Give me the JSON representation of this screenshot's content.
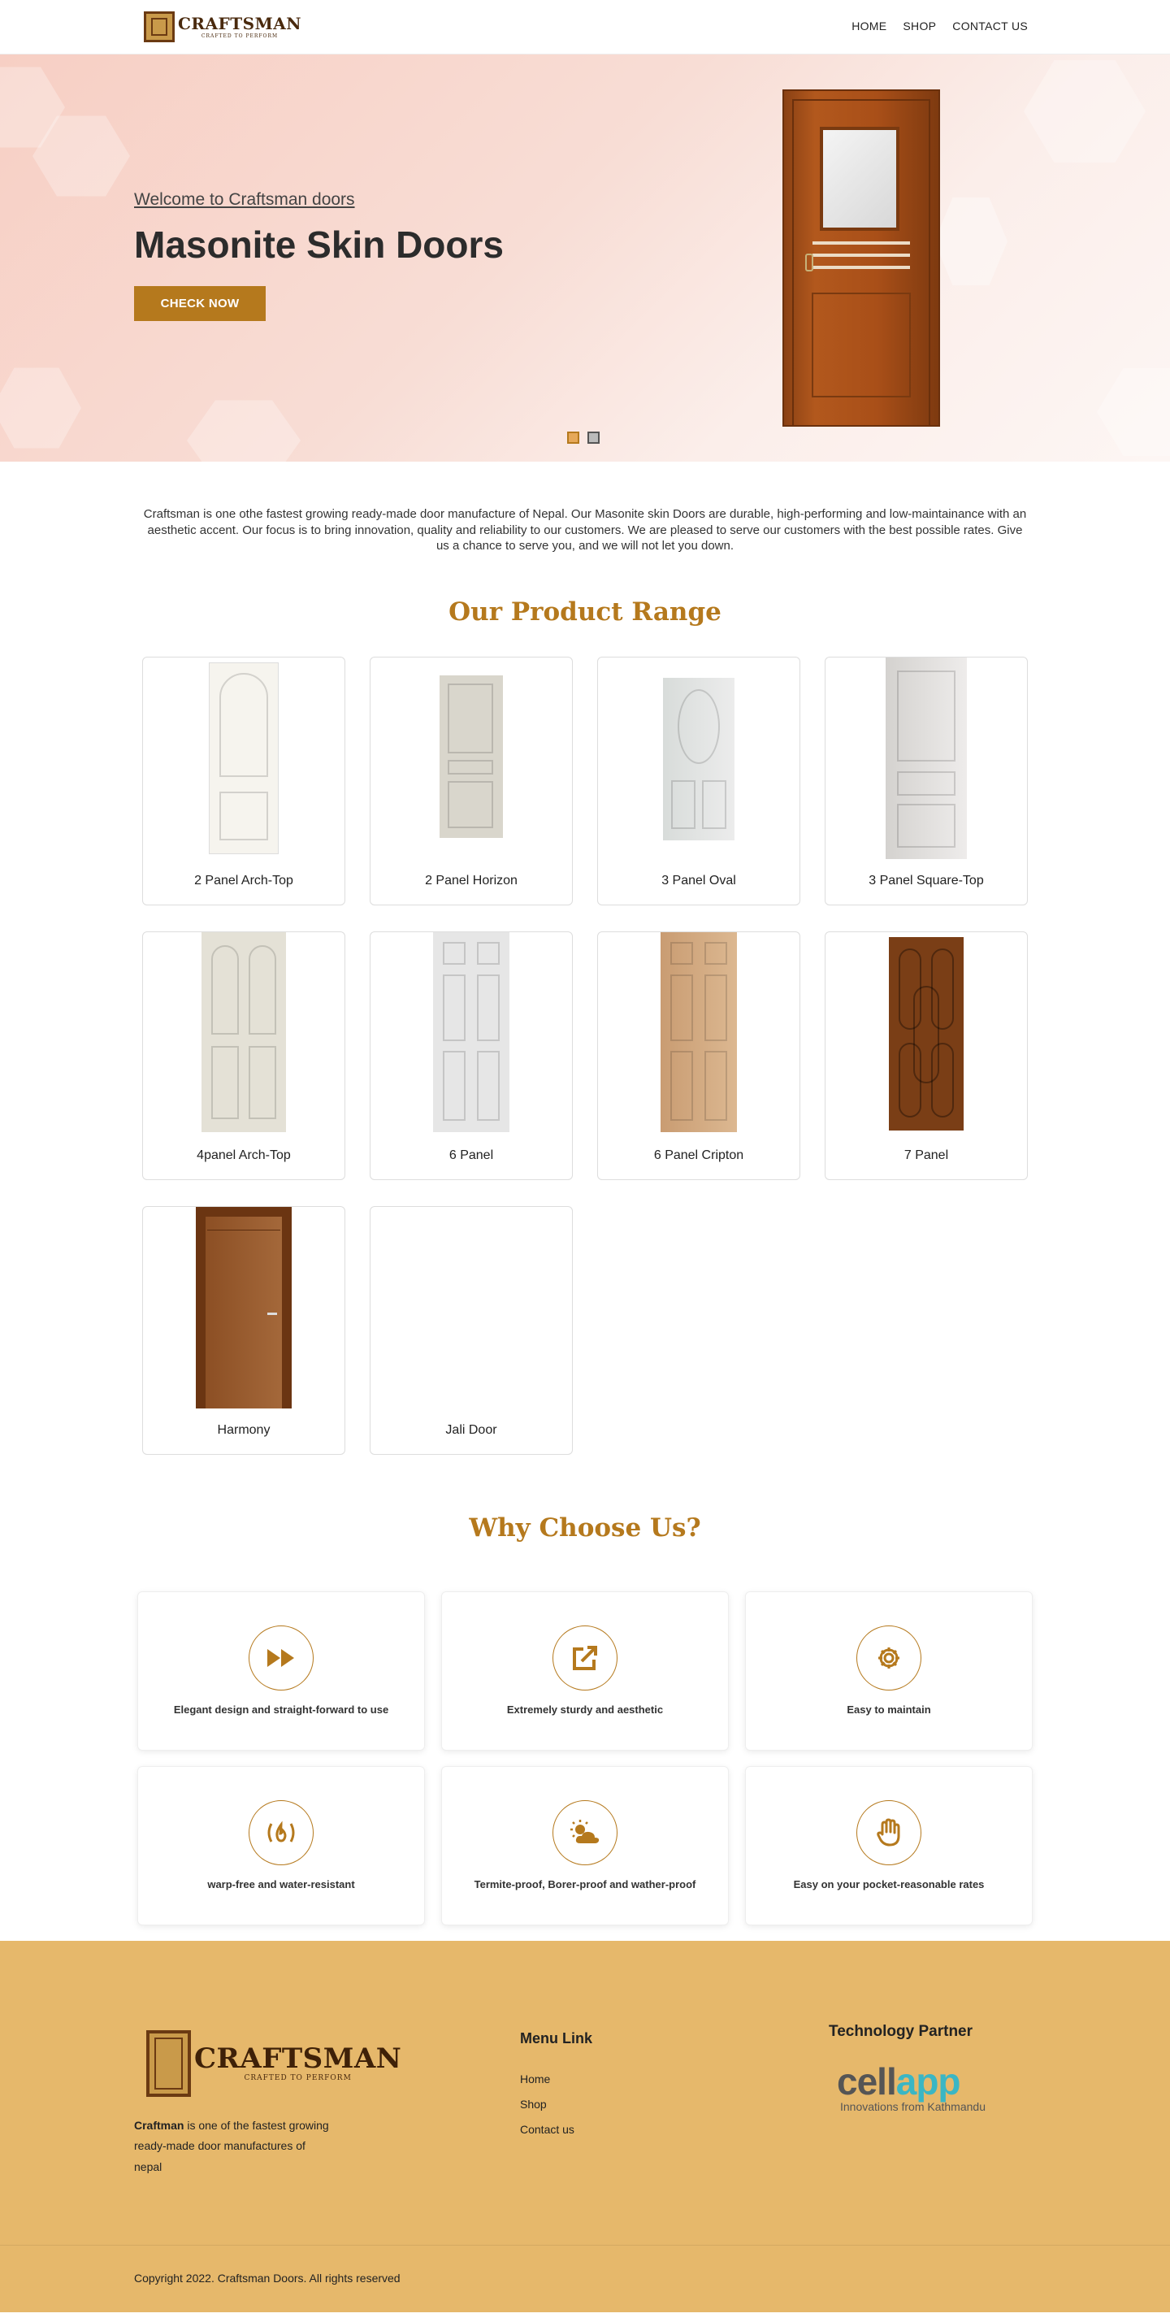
{
  "header": {
    "brand": "CRAFTSMAN",
    "tagline": "CRAFTED TO PERFORM",
    "nav": [
      "HOME",
      "SHOP",
      "CONTACT US"
    ]
  },
  "hero": {
    "welcome": "Welcome to Craftsman doors",
    "title": "Masonite Skin Doors",
    "button": "CHECK NOW",
    "slides": 2,
    "active_slide": 1
  },
  "intro": "Craftsman is one othe fastest growing ready-made door manufacture of Nepal. Our Masonite skin Doors are durable, high-performing and low-maintainance with an aesthetic accent. Our focus is to bring innovation, quality and reliability to our customers. We are pleased to serve our customers with the best possible rates. Give us a chance to serve you, and we will not let you down.",
  "products_title": "Our Product Range",
  "products": [
    {
      "name": "2 Panel Arch-Top",
      "color": "#f6f4ee"
    },
    {
      "name": "2 Panel Horizon",
      "color": "#d9d6cc"
    },
    {
      "name": "3 Panel Oval",
      "color": "#dcdede"
    },
    {
      "name": "3 Panel Square-Top",
      "color": "#e2e0dd"
    },
    {
      "name": "4panel Arch-Top",
      "color": "#e4e1d6"
    },
    {
      "name": "6 Panel",
      "color": "#e6e6e6"
    },
    {
      "name": "6 Panel Cripton",
      "color": "#d2ab83"
    },
    {
      "name": "7 Panel",
      "color": "#7a3e16"
    },
    {
      "name": "Harmony",
      "color": "#9a5a2c"
    },
    {
      "name": "Jali Door",
      "color": ""
    }
  ],
  "why_title": "Why Choose Us?",
  "features": [
    {
      "icon": "fast-forward-icon",
      "text": "Elegant design and straight-forward to use"
    },
    {
      "icon": "external-link-icon",
      "text": "Extremely sturdy and aesthetic"
    },
    {
      "icon": "gear-icon",
      "text": "Easy to maintain"
    },
    {
      "icon": "fire-icon",
      "text": "warp-free and water-resistant"
    },
    {
      "icon": "sun-cloud-icon",
      "text": "Termite-proof, Borer-proof and wather-proof"
    },
    {
      "icon": "hand-icon",
      "text": "Easy on your pocket-reasonable rates"
    }
  ],
  "footer": {
    "about_bold": "Craftman",
    "about_rest": " is one of the fastest growing ready-made door manufactures of nepal",
    "menu_title": "Menu Link",
    "menu": [
      "Home",
      "Shop",
      "Contact us"
    ],
    "tech_title": "Technology Partner",
    "partner_name_a": "cell",
    "partner_name_b": "app",
    "partner_tagline": "Innovations from Kathmandu",
    "copyright": "Copyright 2022. Craftsman Doors. All rights reserved"
  },
  "colors": {
    "accent": "#b5791d",
    "footer_bg": "#e6b86b"
  }
}
